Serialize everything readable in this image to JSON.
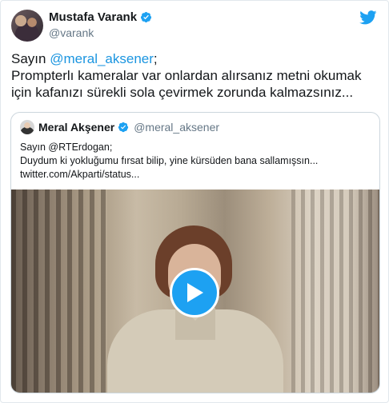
{
  "tweet": {
    "author_name": "Mustafa Varank",
    "author_handle": "@varank",
    "text_prefix": "Sayın ",
    "mention": "@meral_aksener",
    "text_suffix": ";",
    "line2": "Prompterlı kameralar var onlardan alırsanız metni okumak",
    "line3": "için kafanızı sürekli sola çevirmek zorunda kalmazsınız..."
  },
  "quoted_tweet": {
    "author_name": "Meral Akşener",
    "author_handle": "@meral_aksener",
    "line1": "Sayın @RTErdogan;",
    "line2": "Duydum ki yokluğumu fırsat bilip, yine kürsüden bana sallamışsın...",
    "line3": "twitter.com/Akparti/status..."
  },
  "colors": {
    "link": "#1b95e0",
    "twitter_blue": "#1da1f2",
    "text": "#14171a",
    "secondary": "#657786"
  },
  "icons": {
    "brand": "twitter-bird-icon",
    "verified": "verified-badge-icon",
    "media": "play-icon"
  }
}
